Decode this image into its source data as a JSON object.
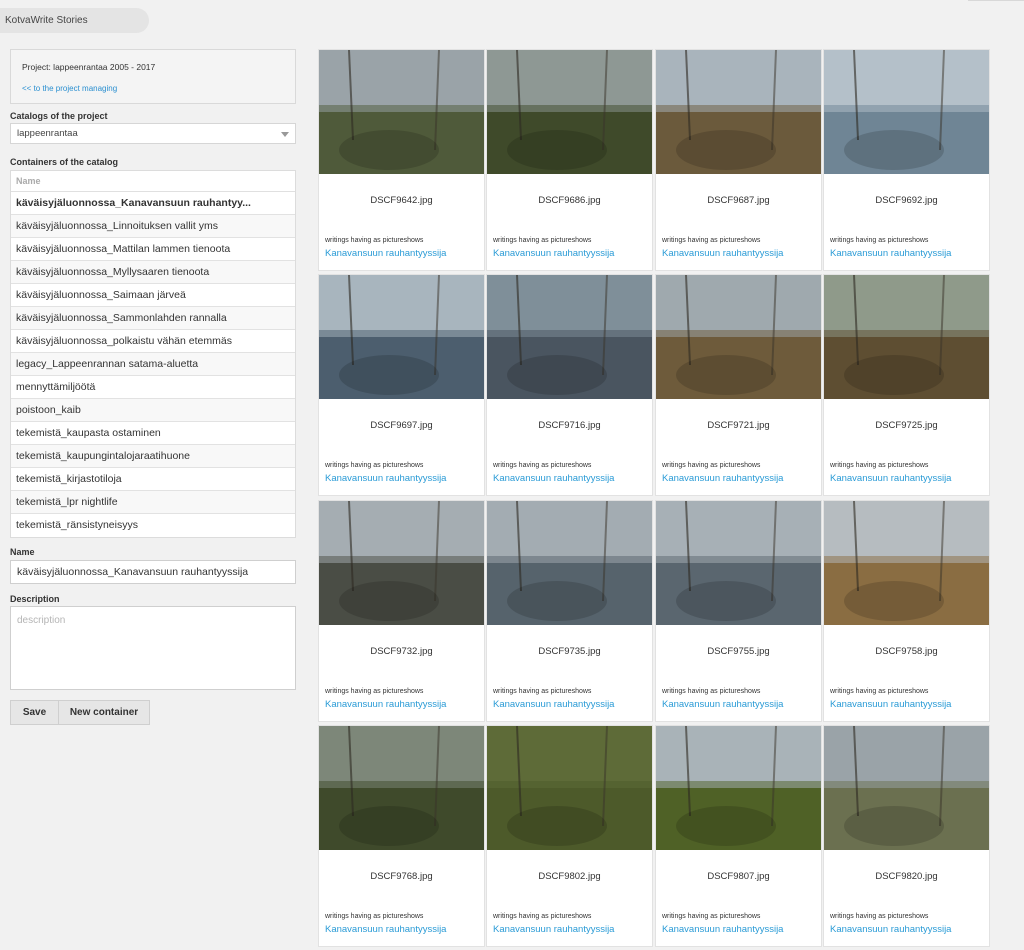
{
  "app": {
    "title": "KotvaWrite Stories"
  },
  "project": {
    "label": "Project: lappeenrantaa 2005 - 2017",
    "back_link": "<< to the project managing"
  },
  "catalogs": {
    "label": "Catalogs of the project",
    "selected": "lappeenrantaa"
  },
  "containers": {
    "label": "Containers of the catalog",
    "column_header": "Name",
    "items": [
      "käväisyjäluonnossa_Kanavansuun rauhantyy...",
      "käväisyjäluonnossa_Linnoituksen vallit yms",
      "käväisyjäluonnossa_Mattilan lammen tienoota",
      "käväisyjäluonnossa_Myllysaaren tienoota",
      "käväisyjäluonnossa_Saimaan järveä",
      "käväisyjäluonnossa_Sammonlahden rannalla",
      "käväisyjäluonnossa_polkaistu vähän etemmäs",
      "legacy_Lappeenrannan satama-aluetta",
      "mennyttämiljöötä",
      "poistoon_kaib",
      "tekemistä_kaupasta ostaminen",
      "tekemistä_kaupungintalojaraatihuone",
      "tekemistä_kirjastotiloja",
      "tekemistä_lpr nightlife",
      "tekemistä_ränsistyneisyys"
    ]
  },
  "form": {
    "name_label": "Name",
    "name_value": "käväisyjäluonnossa_Kanavansuun rauhantyyssija",
    "description_label": "Description",
    "description_placeholder": "description",
    "save_label": "Save",
    "new_container_label": "New container"
  },
  "photos": [
    {
      "file": "DSCF9642.jpg",
      "writings_label": "writings having as pictureshows",
      "link": "Kanavansuun rauhantyyssija",
      "sky": "#9aa3a8",
      "ground": "#4f5a3a"
    },
    {
      "file": "DSCF9686.jpg",
      "writings_label": "writings having as pictureshows",
      "link": "Kanavansuun rauhantyyssija",
      "sky": "#8e9894",
      "ground": "#3f4a2a"
    },
    {
      "file": "DSCF9687.jpg",
      "writings_label": "writings having as pictureshows",
      "link": "Kanavansuun rauhantyyssija",
      "sky": "#a9b4bc",
      "ground": "#6b5a3c"
    },
    {
      "file": "DSCF9692.jpg",
      "writings_label": "writings having as pictureshows",
      "link": "Kanavansuun rauhantyyssija",
      "sky": "#b4c0c9",
      "ground": "#6f8595"
    },
    {
      "file": "DSCF9697.jpg",
      "writings_label": "writings having as pictureshows",
      "link": "Kanavansuun rauhantyyssija",
      "sky": "#a8b5be",
      "ground": "#4c5e6e"
    },
    {
      "file": "DSCF9716.jpg",
      "writings_label": "writings having as pictureshows",
      "link": "Kanavansuun rauhantyyssija",
      "sky": "#7f8f99",
      "ground": "#4a5560"
    },
    {
      "file": "DSCF9721.jpg",
      "writings_label": "writings having as pictureshows",
      "link": "Kanavansuun rauhantyyssija",
      "sky": "#9fa9ae",
      "ground": "#6e5b3b"
    },
    {
      "file": "DSCF9725.jpg",
      "writings_label": "writings having as pictureshows",
      "link": "Kanavansuun rauhantyyssija",
      "sky": "#8f9a8a",
      "ground": "#5e4e32"
    },
    {
      "file": "DSCF9732.jpg",
      "writings_label": "writings having as pictureshows",
      "link": "Kanavansuun rauhantyyssija",
      "sky": "#a5adb2",
      "ground": "#4a4d45"
    },
    {
      "file": "DSCF9735.jpg",
      "writings_label": "writings having as pictureshows",
      "link": "Kanavansuun rauhantyyssija",
      "sky": "#a3acb2",
      "ground": "#56636c"
    },
    {
      "file": "DSCF9755.jpg",
      "writings_label": "writings having as pictureshows",
      "link": "Kanavansuun rauhantyyssija",
      "sky": "#a7b0b6",
      "ground": "#5a666f"
    },
    {
      "file": "DSCF9758.jpg",
      "writings_label": "writings having as pictureshows",
      "link": "Kanavansuun rauhantyyssija",
      "sky": "#b6bcc0",
      "ground": "#8a6d42"
    },
    {
      "file": "DSCF9768.jpg",
      "writings_label": "writings having as pictureshows",
      "link": "Kanavansuun rauhantyyssija",
      "sky": "#7d8779",
      "ground": "#3f4a2b"
    },
    {
      "file": "DSCF9802.jpg",
      "writings_label": "writings having as pictureshows",
      "link": "Kanavansuun rauhantyyssija",
      "sky": "#5e6b38",
      "ground": "#4d5a2a"
    },
    {
      "file": "DSCF9807.jpg",
      "writings_label": "writings having as pictureshows",
      "link": "Kanavansuun rauhantyyssija",
      "sky": "#a9b3b8",
      "ground": "#4f6126"
    },
    {
      "file": "DSCF9820.jpg",
      "writings_label": "writings having as pictureshows",
      "link": "Kanavansuun rauhantyyssija",
      "sky": "#9aa3a8",
      "ground": "#6b7050"
    }
  ]
}
